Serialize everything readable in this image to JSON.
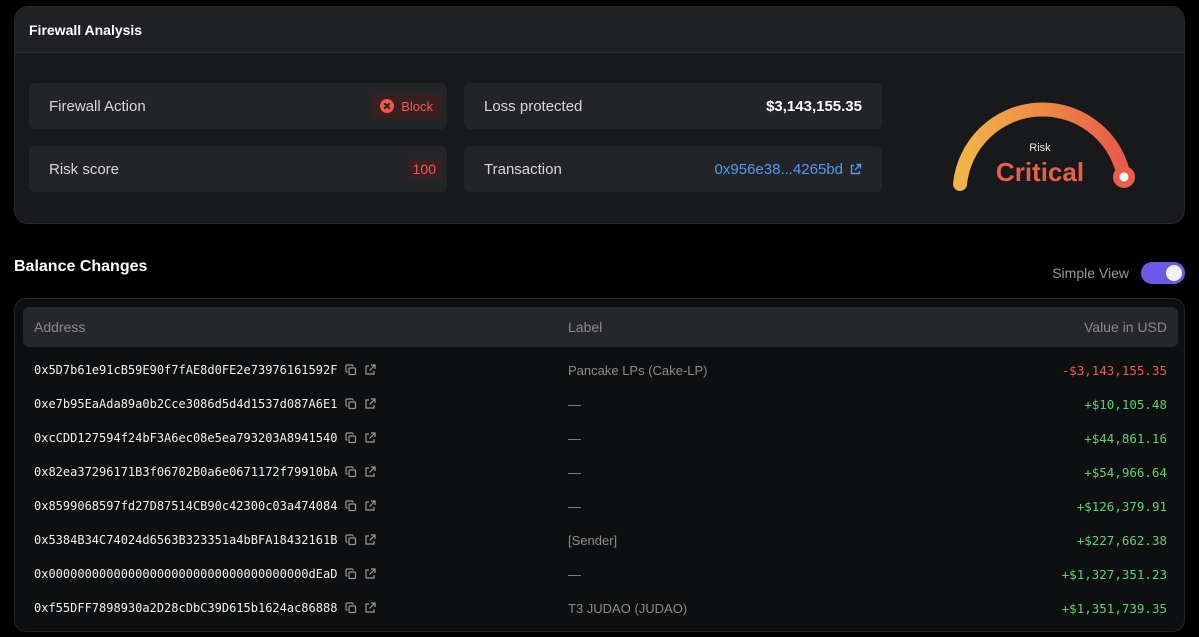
{
  "firewall": {
    "title": "Firewall Analysis",
    "action_label": "Firewall Action",
    "action_value": "Block",
    "loss_label": "Loss protected",
    "loss_value": "$3,143,155.35",
    "risk_label": "Risk score",
    "risk_value": "100",
    "tx_label": "Transaction",
    "tx_value": "0x956e38...4265bd",
    "gauge": {
      "small_label": "Risk",
      "big_label": "Critical",
      "level": 1.0
    }
  },
  "balance": {
    "title": "Balance Changes",
    "simple_view_label": "Simple View",
    "simple_view_on": true,
    "headers": {
      "address": "Address",
      "label": "Label",
      "value": "Value in USD"
    },
    "rows": [
      {
        "address": "0x5D7b61e91cB59E90f7fAE8d0FE2e73976161592F",
        "label": "Pancake LPs (Cake-LP)",
        "value": "-$3,143,155.35",
        "sign": "neg"
      },
      {
        "address": "0xe7b95EaAda89a0b2Cce3086d5d4d1537d087A6E1",
        "label": "—",
        "value": "+$10,105.48",
        "sign": "pos"
      },
      {
        "address": "0xcCDD127594f24bF3A6ec08e5ea793203A8941540",
        "label": "—",
        "value": "+$44,861.16",
        "sign": "pos"
      },
      {
        "address": "0x82ea37296171B3f06702B0a6e0671172f79910bA",
        "label": "—",
        "value": "+$54,966.64",
        "sign": "pos"
      },
      {
        "address": "0x8599068597fd27D87514CB90c42300c03a474084",
        "label": "—",
        "value": "+$126,379.91",
        "sign": "pos"
      },
      {
        "address": "0x5384B34C74024d6563B323351a4bBFA18432161B",
        "label": "[Sender]",
        "value": "+$227,662.38",
        "sign": "pos"
      },
      {
        "address": "0x000000000000000000000000000000000000dEaD",
        "label": "—",
        "value": "+$1,327,351.23",
        "sign": "pos"
      },
      {
        "address": "0xf55DFF7898930a2D28cDbC39D615b1624ac86888",
        "label": "T3 JUDAO (JUDAO)",
        "value": "+$1,351,739.35",
        "sign": "pos"
      }
    ]
  },
  "colors": {
    "accent": "#6a5ae8",
    "link": "#4e9bf5",
    "negative": "#ef5a4d",
    "positive": "#5fd16d",
    "critical": "#e8604a"
  }
}
